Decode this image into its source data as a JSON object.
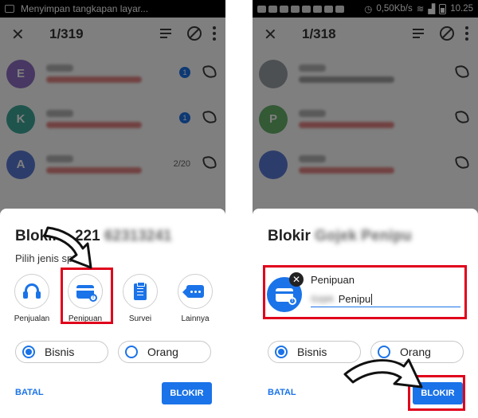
{
  "left": {
    "status_text": "Menyimpan tangkapan layar...",
    "counter": "1/319",
    "calls": [
      {
        "initial": "E",
        "color": "#8e6fc4",
        "badge": "1",
        "extra": ""
      },
      {
        "initial": "K",
        "color": "#3fa89b",
        "badge": "1",
        "extra": ""
      },
      {
        "initial": "A",
        "color": "#5a7bd6",
        "badge": "",
        "extra": "2/20"
      }
    ],
    "dialog": {
      "title_prefix": "Blokir",
      "title_number": "221",
      "subtitle": "Pilih jenis sp",
      "categories": [
        {
          "icon": "headset-icon",
          "label": "Penjualan"
        },
        {
          "icon": "credit-card-alert-icon",
          "label": "Penipuan"
        },
        {
          "icon": "clipboard-icon",
          "label": "Survei"
        },
        {
          "icon": "chat-dots-icon",
          "label": "Lainnya"
        }
      ],
      "radio_business": "Bisnis",
      "radio_person": "Orang",
      "cancel_label": "BATAL",
      "block_label": "BLOKIR"
    }
  },
  "right": {
    "status_speed": "0,50Kb/s",
    "status_time": "10.25",
    "counter": "1/318",
    "calls": [
      {
        "initial": "",
        "color": "#9aa0a6"
      },
      {
        "initial": "P",
        "color": "#67b26b"
      },
      {
        "initial": "",
        "color": "#5a7bd6"
      }
    ],
    "dialog": {
      "title_prefix": "Blokir",
      "field_label": "Penipuan",
      "name_value": "Penipu",
      "remove_label": "✕",
      "radio_business": "Bisnis",
      "radio_person": "Orang",
      "cancel_label": "BATAL",
      "block_label": "BLOKIR"
    }
  },
  "colors": {
    "accent": "#1a73e8",
    "annotation_red": "#e0001b"
  }
}
